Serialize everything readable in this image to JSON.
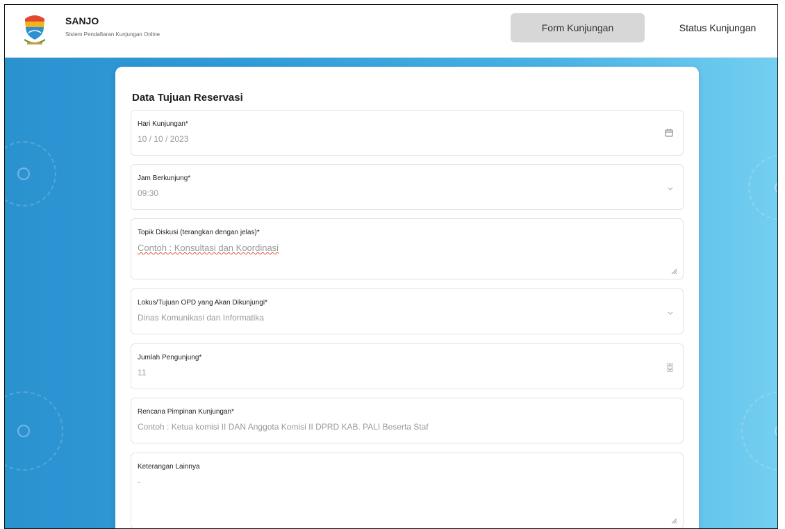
{
  "app": {
    "title": "SANJO",
    "subtitle": "Sistem Pendaftaran Kunjungan Online"
  },
  "nav": {
    "form_label": "Form Kunjungan",
    "status_label": "Status Kunjungan"
  },
  "form": {
    "section_title": "Data Tujuan Reservasi",
    "fields": [
      {
        "label": "Hari Kunjungan*",
        "value": "10 / 10 / 2023",
        "icon": "calendar-icon"
      },
      {
        "label": "Jam Berkunjung*",
        "value": "09:30",
        "icon": "chevron-down-icon"
      },
      {
        "label": "Topik Diskusi (terangkan dengan jelas)*",
        "placeholder": "Contoh : Konsultasi dan Koordinasi"
      },
      {
        "label": "Lokus/Tujuan OPD yang Akan Dikunjungi*",
        "value": "Dinas Komunikasi dan Informatika",
        "icon": "chevron-down-icon"
      },
      {
        "label": "Jumlah Pengunjung*",
        "value": "11",
        "icon": "number-stepper-icon"
      },
      {
        "label": "Rencana Pimpinan Kunjungan*",
        "placeholder": "Contoh : Ketua komisi II DAN Anggota Komisi II DPRD KAB. PALI Beserta Staf"
      },
      {
        "label": "Keterangan Lainnya",
        "value": "-"
      }
    ]
  },
  "colors": {
    "background_left": "#2b92d0",
    "background_right": "#74cff0",
    "active_nav_bg": "#d7d7d7"
  }
}
